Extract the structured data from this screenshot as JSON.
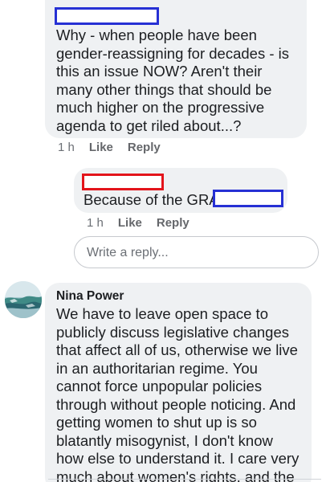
{
  "comment1": {
    "text": "Why - when people have been gender-reassigning for decades - is this an issue NOW? Aren't their many other things that should be much higher on the progressive agenda to get riled about...?",
    "time": "1 h",
    "like_label": "Like",
    "reply_label": "Reply"
  },
  "reply1": {
    "text": "Because of the GRA",
    "time": "1 h",
    "like_label": "Like",
    "reply_label": "Reply"
  },
  "reply_input": {
    "placeholder": "Write a reply..."
  },
  "comment2": {
    "author": "Nina Power",
    "text": "We have to leave open space to publicly discuss legislative changes that affect all of us, otherwise we live in an authoritarian regime. You cannot force unpopular policies through without people noticing. And getting women to shut up is so blatantly misogynist, I don't know how else to understand it. I care very much about women's rights, and the right to a"
  },
  "colors": {
    "bubble": "#eff1f3",
    "redaction_blue": "#2630d4",
    "redaction_red": "#e3141b"
  }
}
